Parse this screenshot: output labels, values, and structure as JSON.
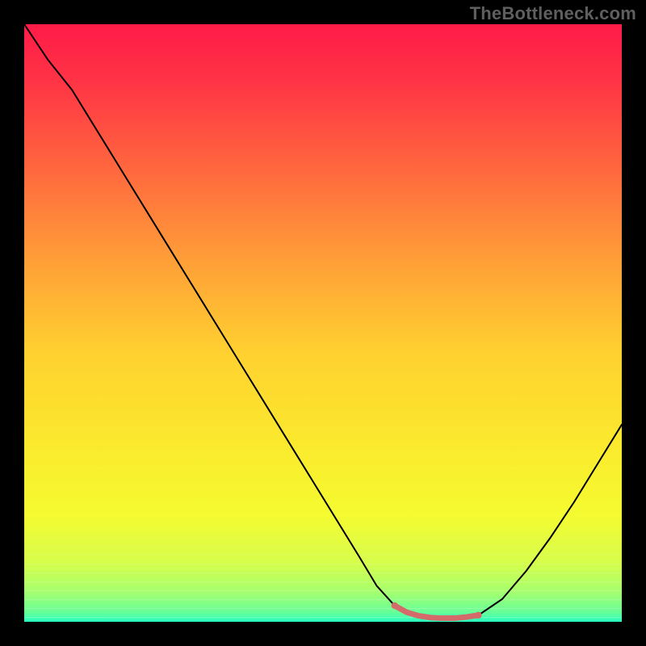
{
  "watermark": "TheBottleneck.com",
  "chart_data": {
    "type": "line",
    "title": "",
    "xlabel": "",
    "ylabel": "",
    "xlim": [
      0,
      100
    ],
    "ylim": [
      0,
      100
    ],
    "background_gradient": {
      "stops": [
        {
          "offset": 0.0,
          "color": "#ff1b48"
        },
        {
          "offset": 0.1,
          "color": "#ff3545"
        },
        {
          "offset": 0.25,
          "color": "#ff6a3e"
        },
        {
          "offset": 0.4,
          "color": "#ffa037"
        },
        {
          "offset": 0.55,
          "color": "#ffd130"
        },
        {
          "offset": 0.7,
          "color": "#fbe92d"
        },
        {
          "offset": 0.82,
          "color": "#f5fb30"
        },
        {
          "offset": 0.9,
          "color": "#d7fd4b"
        },
        {
          "offset": 0.95,
          "color": "#a6ff6e"
        },
        {
          "offset": 0.985,
          "color": "#64ff9a"
        },
        {
          "offset": 1.0,
          "color": "#26ffc0"
        }
      ]
    },
    "series": [
      {
        "name": "bottleneck-curve",
        "color": "#000000",
        "width": 2,
        "x": [
          0,
          4,
          8,
          12,
          16,
          20,
          24,
          28,
          32,
          36,
          40,
          44,
          48,
          52,
          56,
          59,
          62,
          66,
          70,
          73,
          76,
          80,
          84,
          88,
          92,
          96,
          100
        ],
        "y": [
          100,
          94,
          89,
          82.5,
          76,
          69.5,
          63,
          56.5,
          50,
          43.5,
          37,
          30.5,
          24,
          17.5,
          11,
          6,
          2.7,
          1.0,
          0.6,
          0.6,
          1.1,
          3.8,
          8.5,
          14,
          20,
          26.5,
          33
        ]
      }
    ],
    "highlight": {
      "name": "optimal-range",
      "color": "#d46a6a",
      "width": 7,
      "x": [
        62,
        64,
        66,
        68,
        70,
        72,
        74,
        76
      ],
      "y": [
        2.7,
        1.6,
        1.0,
        0.7,
        0.6,
        0.6,
        0.8,
        1.1
      ]
    }
  }
}
